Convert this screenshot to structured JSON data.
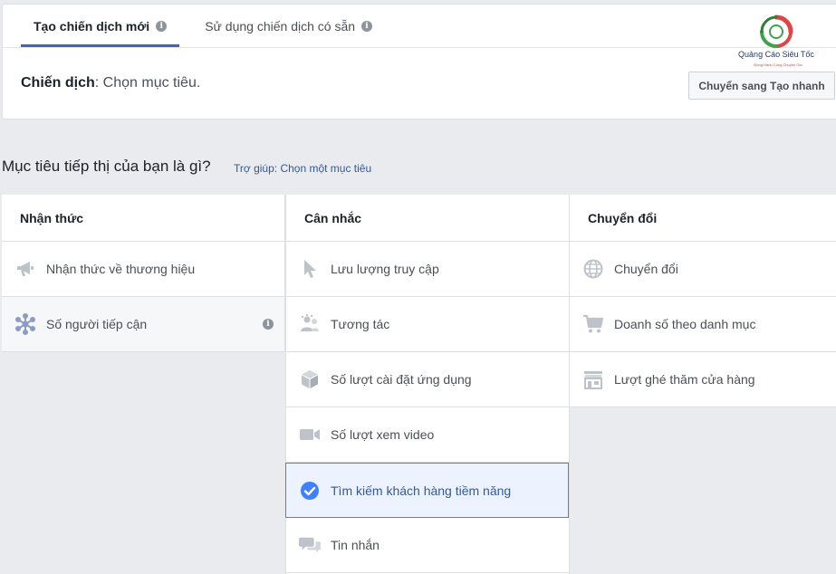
{
  "tabs": [
    {
      "label": "Tạo chiến dịch mới",
      "active": true
    },
    {
      "label": "Sử dụng chiến dịch có sẵn",
      "active": false
    }
  ],
  "campaign": {
    "label": "Chiến dịch",
    "value": ": Chọn mục tiêu."
  },
  "quick_button": "Chuyển sang Tạo nhanh",
  "logo": {
    "name": "Quảng Cáo Siêu Tốc",
    "tagline": "Đồng Hành Cùng Chuyên Gia"
  },
  "question": "Mục tiêu tiếp thị của bạn là gì?",
  "help_link": "Trợ giúp: Chọn một mục tiêu",
  "columns": [
    {
      "title": "Nhận thức",
      "items": [
        {
          "label": "Nhận thức về thương hiệu",
          "icon": "megaphone-icon"
        },
        {
          "label": "Số người tiếp cận",
          "icon": "reach-icon",
          "info": true
        }
      ]
    },
    {
      "title": "Cân nhắc",
      "items": [
        {
          "label": "Lưu lượng truy cập",
          "icon": "cursor-icon"
        },
        {
          "label": "Tương tác",
          "icon": "people-icon"
        },
        {
          "label": "Số lượt cài đặt ứng dụng",
          "icon": "box-icon"
        },
        {
          "label": "Số lượt xem video",
          "icon": "video-camera-icon"
        },
        {
          "label": "Tìm kiếm khách hàng tiềm năng",
          "icon": "checkmark-icon",
          "selected": true
        },
        {
          "label": "Tin nhắn",
          "icon": "chat-bubbles-icon"
        }
      ]
    },
    {
      "title": "Chuyển đổi",
      "items": [
        {
          "label": "Chuyển đổi",
          "icon": "globe-icon"
        },
        {
          "label": "Doanh số theo danh mục",
          "icon": "shopping-cart-icon"
        },
        {
          "label": "Lượt ghé thăm cửa hàng",
          "icon": "store-icon"
        }
      ]
    }
  ],
  "colors": {
    "accent": "#4267b2",
    "selected_border": "#4080ff",
    "selected_bg": "#ecf3ff",
    "icon_gray": "#bec3c9",
    "link": "#365899"
  }
}
